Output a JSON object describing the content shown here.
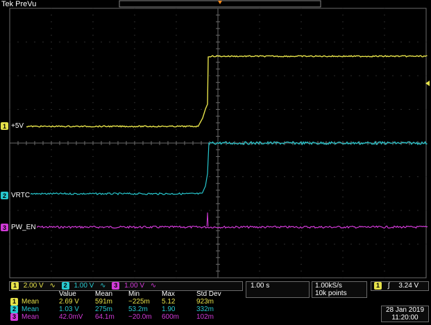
{
  "header": {
    "title": "Tek PreVu"
  },
  "channels": [
    {
      "id": "1",
      "label": "+5V",
      "scale": "2.00 V",
      "color": "#e6e24a"
    },
    {
      "id": "2",
      "label": "VRTC",
      "scale": "1.00 V",
      "color": "#27c8cf"
    },
    {
      "id": "3",
      "label": "PW_EN",
      "scale": "1.00 V",
      "color": "#d23ad8"
    }
  ],
  "bandwidth_symbol": "∿",
  "timebase": {
    "scale": "1.00 s"
  },
  "acquisition": {
    "rate": "1.00kS/s",
    "points": "10k points"
  },
  "trigger": {
    "channel": "1",
    "slope_symbol": "∫",
    "level": "3.24 V"
  },
  "measurements": {
    "headers": [
      "Value",
      "Mean",
      "Min",
      "Max",
      "Std Dev"
    ],
    "rows": [
      {
        "channel": "1",
        "type": "Mean",
        "value": "2.69 V",
        "mean": "591m",
        "min": "−225m",
        "max": "5.12",
        "std_dev": "923m"
      },
      {
        "channel": "2",
        "type": "Mean",
        "value": "1.03 V",
        "mean": "275m",
        "min": "53.2m",
        "max": "1.90",
        "std_dev": "332m"
      },
      {
        "channel": "3",
        "type": "Mean",
        "value": "42.0mV",
        "mean": "64.1m",
        "min": "−20.0m",
        "max": "600m",
        "std_dev": "102m"
      }
    ]
  },
  "datetime": {
    "date": "28 Jan  2019",
    "time": "11:20:00"
  }
}
